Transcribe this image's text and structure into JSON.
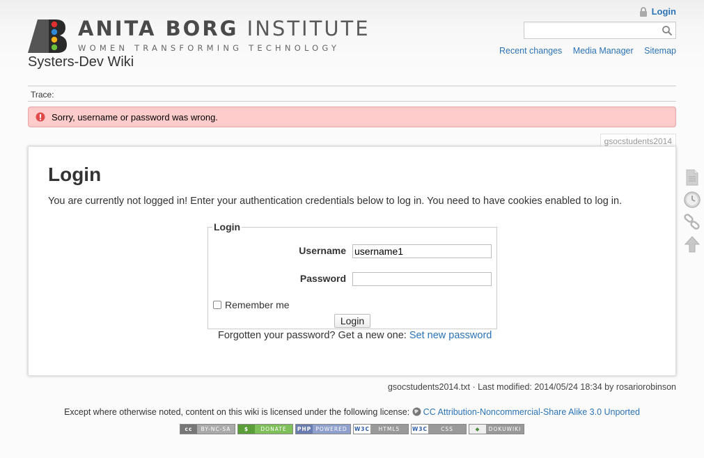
{
  "header": {
    "logo_main_bold": "ANITA BORG",
    "logo_main_rest": " INSTITUTE",
    "logo_sub": "WOMEN TRANSFORMING TECHNOLOGY",
    "site_title": "Systers-Dev Wiki"
  },
  "user_tools": {
    "login_label": "Login",
    "icon": "lock-icon"
  },
  "search": {
    "value": "",
    "placeholder": "",
    "icon": "search-icon"
  },
  "site_tools": [
    {
      "label": "Recent changes"
    },
    {
      "label": "Media Manager"
    },
    {
      "label": "Sitemap"
    }
  ],
  "breadcrumbs": {
    "label": "Trace:"
  },
  "error": {
    "message": "Sorry, username or password was wrong.",
    "icon": "error-icon",
    "color": "#ffcccc"
  },
  "page_id": "gsocstudents2014",
  "main": {
    "heading": "Login",
    "intro": "You are currently not logged in! Enter your authentication credentials below to log in. You need to have cookies enabled to log in.",
    "form": {
      "legend": "Login",
      "username_label": "Username",
      "username_value": "username1",
      "password_label": "Password",
      "password_value": "",
      "remember_label": "Remember me",
      "remember_checked": false,
      "submit_label": "Login"
    },
    "forgot_text": "Forgotten your password? Get a new one: ",
    "forgot_link": "Set new password"
  },
  "page_tools": [
    {
      "name": "show-page-icon"
    },
    {
      "name": "old-revisions-icon"
    },
    {
      "name": "backlinks-icon"
    },
    {
      "name": "back-to-top-icon"
    }
  ],
  "doc_info": "gsocstudents2014.txt · Last modified: 2014/05/24 18:34 by rosariorobinson",
  "license": {
    "text": "Except where otherwise noted, content on this wiki is licensed under the following license: ",
    "link": "CC Attribution-Noncommercial-Share Alike 3.0 Unported"
  },
  "badges": [
    {
      "left": "cc",
      "right": "BY-NC-SA"
    },
    {
      "left": "$",
      "right": "DONATE"
    },
    {
      "left": "PHP",
      "right": "POWERED"
    },
    {
      "left": "W3C",
      "right": "HTML5"
    },
    {
      "left": "W3C",
      "right": "CSS"
    },
    {
      "left": "◆",
      "right": "DOKUWIKI"
    }
  ],
  "colors": {
    "link": "#2b73b7",
    "error_bg": "#ffcccc"
  }
}
